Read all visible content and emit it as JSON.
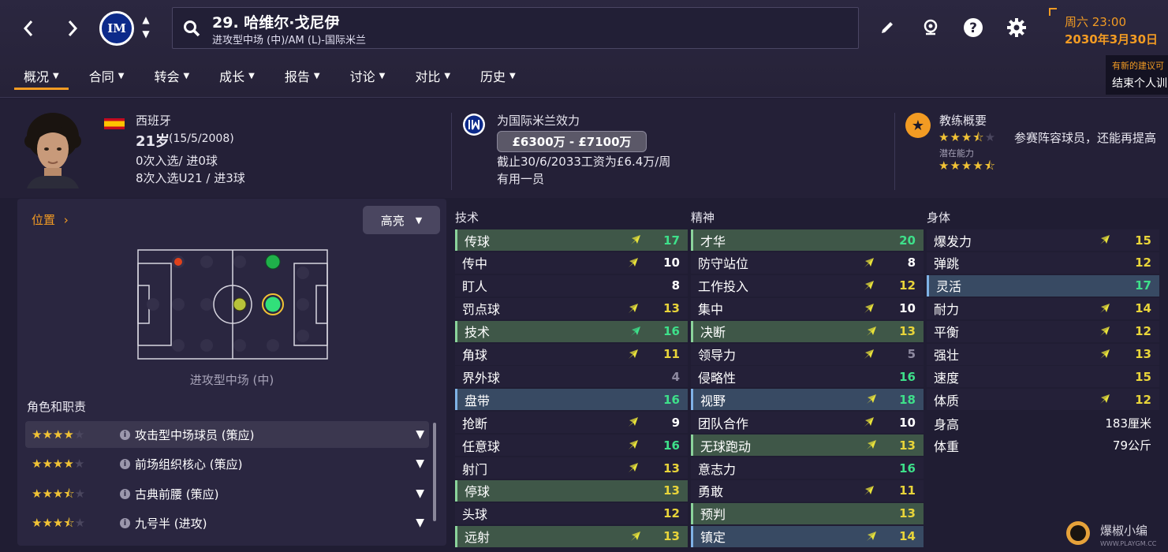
{
  "header": {
    "player_title": "29. 哈维尔·戈尼伊",
    "player_subtitle": "进攻型中场 (中)/AM (L)-国际米兰",
    "club_logo_text": "IM",
    "date_day": "周六 23:00",
    "date_full": "2030年3月30日",
    "notify_title": "有新的建议可",
    "notify_text": "结束个人训"
  },
  "tabs": [
    "概况",
    "合同",
    "转会",
    "成长",
    "报告",
    "讨论",
    "对比",
    "历史"
  ],
  "overview": {
    "nationality": "西班牙",
    "age": "21岁",
    "birth": "(15/5/2008)",
    "caps": "0次入选/ 进0球",
    "u21_caps": "8次入选U21 / 进3球",
    "club_line": "为国际米兰效力",
    "value": "£6300万 - £7100万",
    "contract": "截止30/6/2033工资为£6.4万/周",
    "squad_status": "有用一员",
    "coach_title": "教练概要",
    "coach_text": "参赛阵容球员，还能再提高",
    "potential_label": "潜在能力",
    "current_stars": 3.5,
    "potential_stars": 4.5
  },
  "position": {
    "title": "位置",
    "highlight": "高亮",
    "label": "进攻型中场 (中)"
  },
  "roles": {
    "title": "角色和职责",
    "items": [
      {
        "name": "攻击型中场球员 (策应)",
        "stars": 4
      },
      {
        "name": "前场组织核心 (策应)",
        "stars": 4
      },
      {
        "name": "古典前腰 (策应)",
        "stars": 3.5
      },
      {
        "name": "九号半 (进攻)",
        "stars": 3.5
      }
    ]
  },
  "attributes": {
    "technical_title": "技术",
    "mental_title": "精神",
    "physical_title": "身体",
    "technical": [
      {
        "name": "传球",
        "value": "17",
        "hl": "green",
        "arrow": "up"
      },
      {
        "name": "传中",
        "value": "10",
        "hl": "",
        "arrow": "up"
      },
      {
        "name": "盯人",
        "value": "8",
        "hl": "",
        "arrow": ""
      },
      {
        "name": "罚点球",
        "value": "13",
        "hl": "",
        "arrow": "up"
      },
      {
        "name": "技术",
        "value": "16",
        "hl": "green",
        "arrow": "upgreen"
      },
      {
        "name": "角球",
        "value": "11",
        "hl": "",
        "arrow": "up"
      },
      {
        "name": "界外球",
        "value": "4",
        "hl": "",
        "arrow": ""
      },
      {
        "name": "盘带",
        "value": "16",
        "hl": "blue",
        "arrow": ""
      },
      {
        "name": "抢断",
        "value": "9",
        "hl": "",
        "arrow": "up"
      },
      {
        "name": "任意球",
        "value": "16",
        "hl": "",
        "arrow": "up"
      },
      {
        "name": "射门",
        "value": "13",
        "hl": "",
        "arrow": "up"
      },
      {
        "name": "停球",
        "value": "13",
        "hl": "green",
        "arrow": ""
      },
      {
        "name": "头球",
        "value": "12",
        "hl": "",
        "arrow": ""
      },
      {
        "name": "远射",
        "value": "13",
        "hl": "green",
        "arrow": "up"
      }
    ],
    "mental": [
      {
        "name": "才华",
        "value": "20",
        "hl": "green",
        "arrow": ""
      },
      {
        "name": "防守站位",
        "value": "8",
        "hl": "",
        "arrow": "up"
      },
      {
        "name": "工作投入",
        "value": "12",
        "hl": "",
        "arrow": "up"
      },
      {
        "name": "集中",
        "value": "10",
        "hl": "",
        "arrow": "up"
      },
      {
        "name": "决断",
        "value": "13",
        "hl": "green",
        "arrow": "up"
      },
      {
        "name": "领导力",
        "value": "5",
        "hl": "",
        "arrow": "up"
      },
      {
        "name": "侵略性",
        "value": "16",
        "hl": "",
        "arrow": ""
      },
      {
        "name": "视野",
        "value": "18",
        "hl": "blue",
        "arrow": "up"
      },
      {
        "name": "团队合作",
        "value": "10",
        "hl": "",
        "arrow": "up"
      },
      {
        "name": "无球跑动",
        "value": "13",
        "hl": "green",
        "arrow": "up"
      },
      {
        "name": "意志力",
        "value": "16",
        "hl": "",
        "arrow": ""
      },
      {
        "name": "勇敢",
        "value": "11",
        "hl": "",
        "arrow": "up"
      },
      {
        "name": "预判",
        "value": "13",
        "hl": "green",
        "arrow": ""
      },
      {
        "name": "镇定",
        "value": "14",
        "hl": "blue",
        "arrow": "up"
      }
    ],
    "physical": [
      {
        "name": "爆发力",
        "value": "15",
        "hl": "",
        "arrow": "up"
      },
      {
        "name": "弹跳",
        "value": "12",
        "hl": "",
        "arrow": ""
      },
      {
        "name": "灵活",
        "value": "17",
        "hl": "blue",
        "arrow": ""
      },
      {
        "name": "耐力",
        "value": "14",
        "hl": "",
        "arrow": "up"
      },
      {
        "name": "平衡",
        "value": "12",
        "hl": "",
        "arrow": "up"
      },
      {
        "name": "强壮",
        "value": "13",
        "hl": "",
        "arrow": "up"
      },
      {
        "name": "速度",
        "value": "15",
        "hl": "",
        "arrow": ""
      },
      {
        "name": "体质",
        "value": "12",
        "hl": "",
        "arrow": "up"
      }
    ],
    "bio": [
      {
        "name": "身高",
        "value": "183厘米"
      },
      {
        "name": "体重",
        "value": "79公斤"
      }
    ]
  },
  "watermark": {
    "text": "爆椒小编",
    "url": "WWW.PLAYGM.CC"
  },
  "colors": {
    "accent": "#f29b23",
    "green_value": "#3ee08a",
    "yellow_value": "#e8d43a"
  }
}
